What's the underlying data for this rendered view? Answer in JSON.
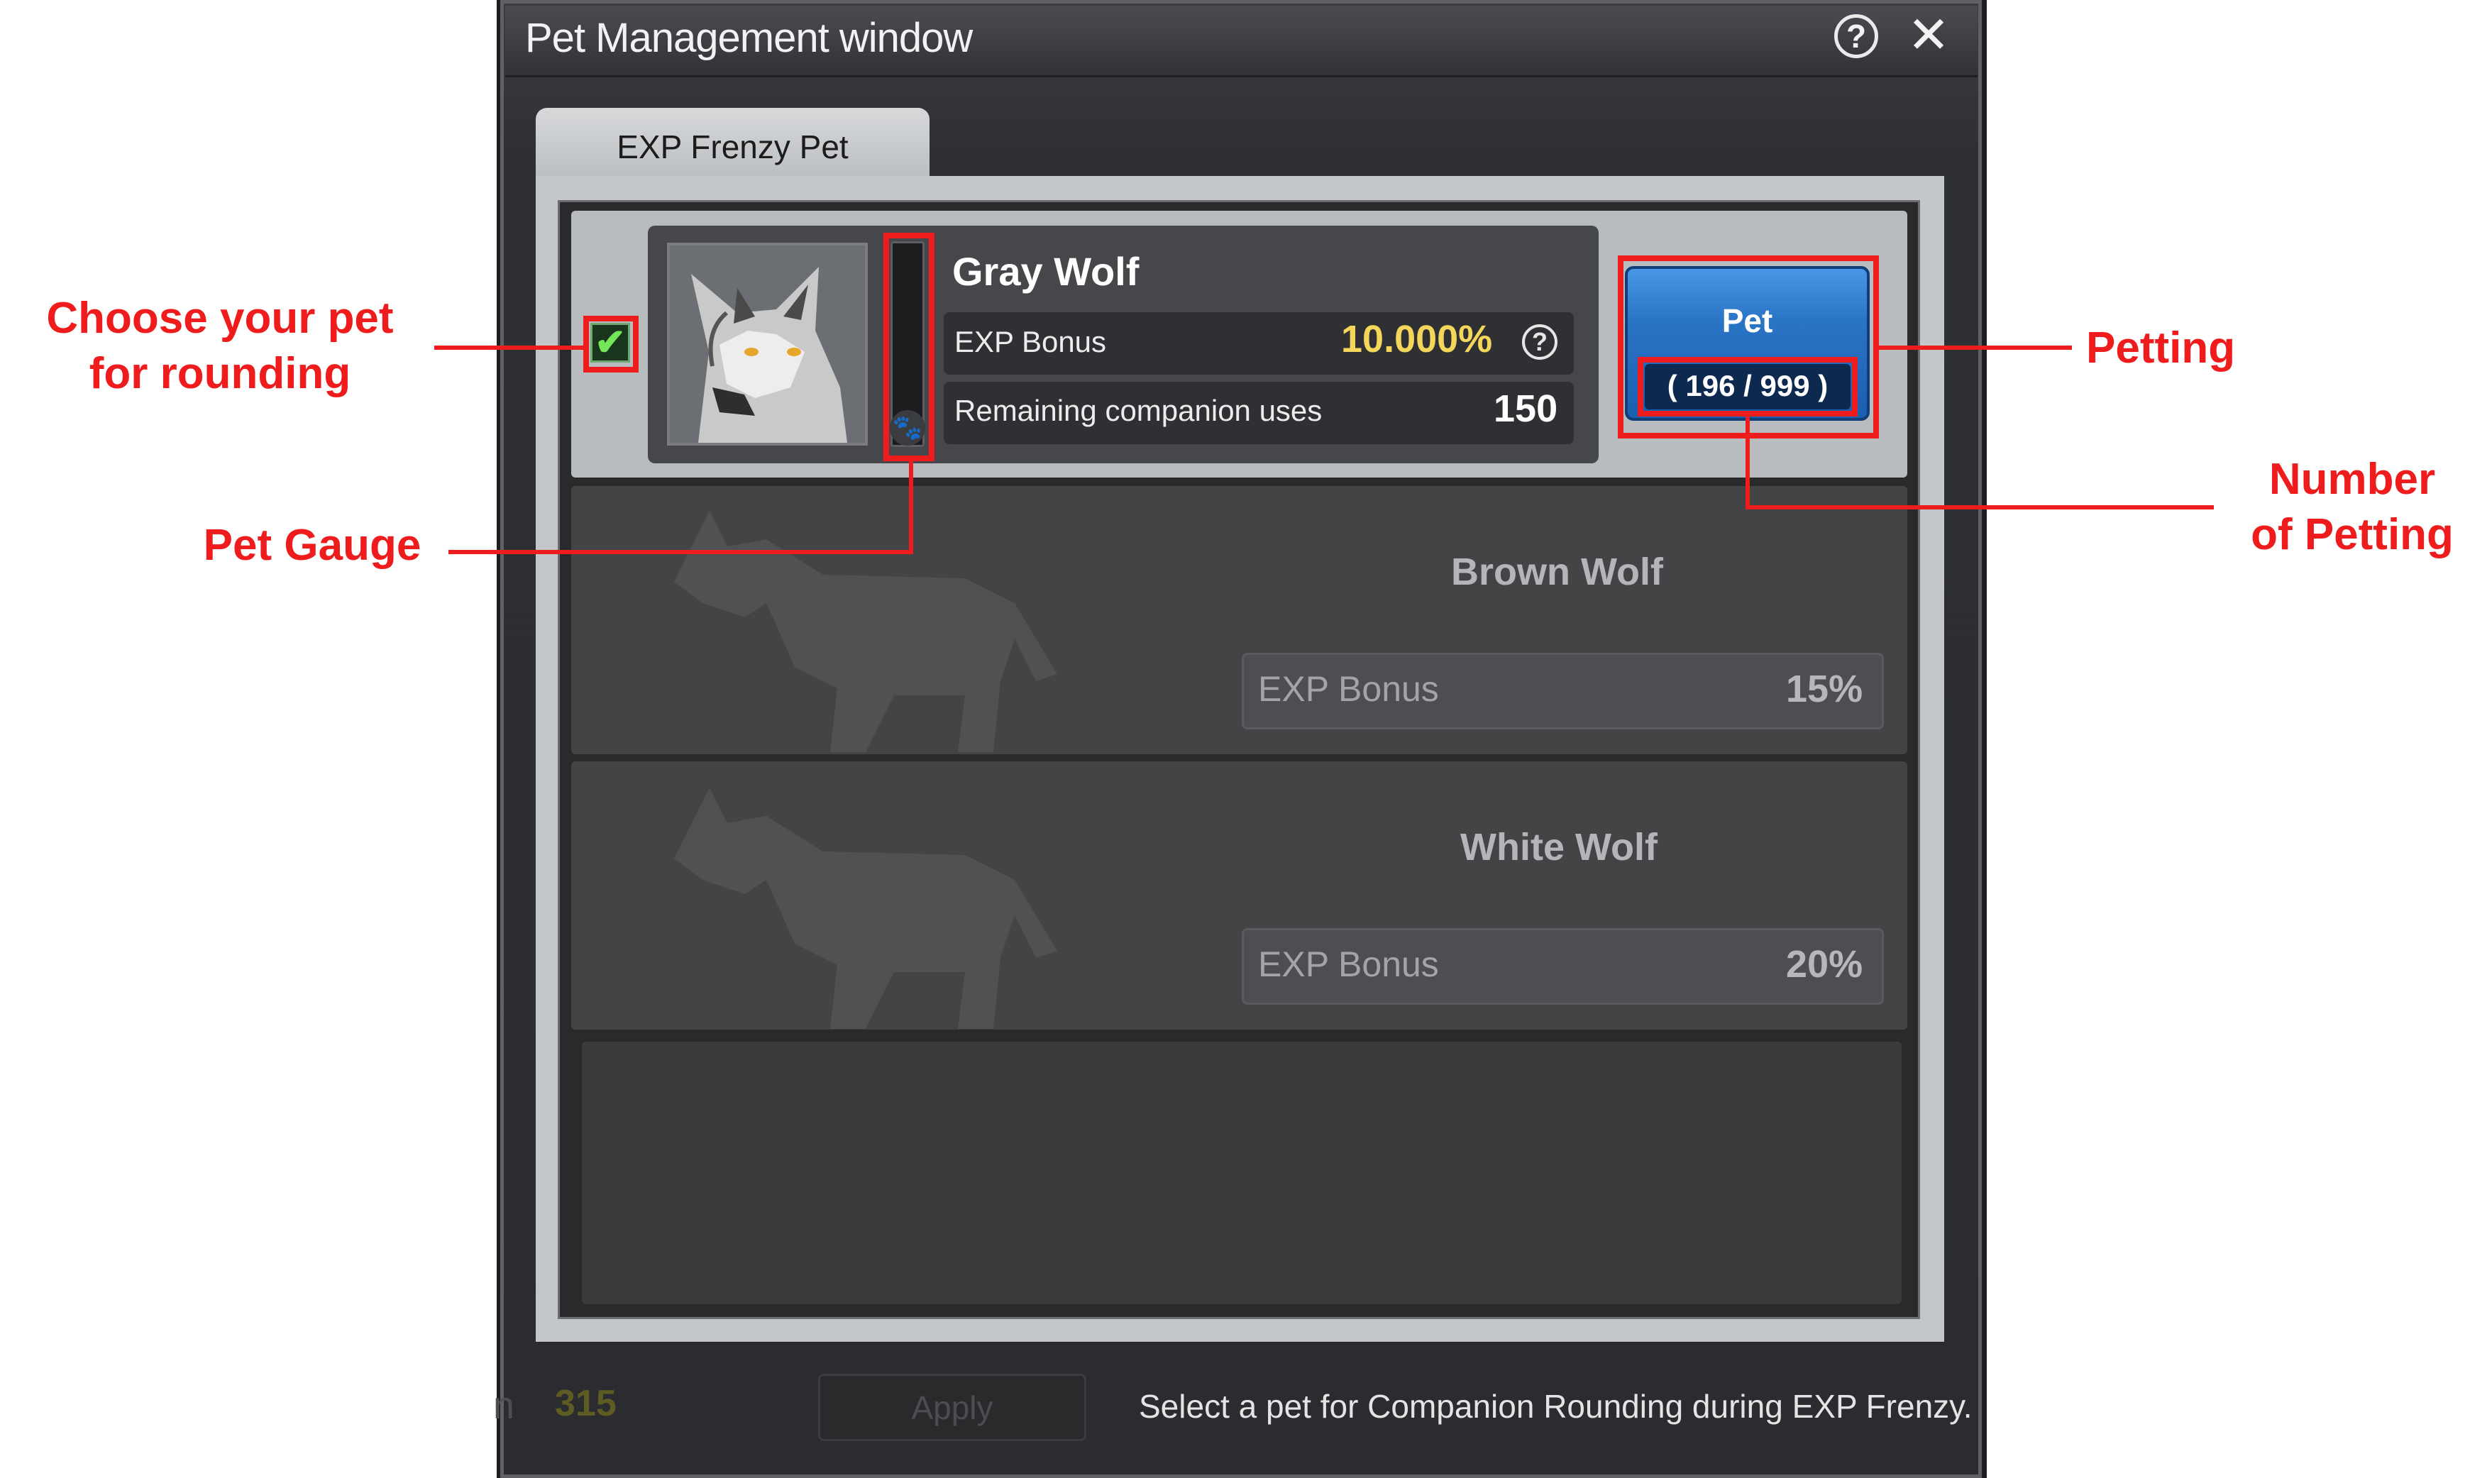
{
  "window": {
    "title": "Pet Management window",
    "help_icon": "question-circle-icon",
    "close_icon": "close-icon",
    "help_glyph": "?",
    "close_glyph": "✕"
  },
  "tabs": [
    {
      "label": "EXP Frenzy Pet"
    }
  ],
  "pets": [
    {
      "name": "Gray Wolf",
      "selected": true,
      "check_glyph": "✔",
      "exp_label": "EXP Bonus",
      "exp_value": "10.000%",
      "remaining_label": "Remaining companion uses",
      "remaining_value": "150",
      "gauge_level": 0,
      "pet_button_label": "Pet",
      "petting_count": "( 196 / 999 )",
      "paw_glyph": "🐾"
    },
    {
      "name": "Brown Wolf",
      "locked": true,
      "exp_label": "EXP Bonus",
      "exp_value": "15%"
    },
    {
      "name": "White Wolf",
      "locked": true,
      "exp_label": "EXP Bonus",
      "exp_value": "20%"
    }
  ],
  "footer": {
    "number_prefix": "n",
    "number": "315",
    "apply_label": "Apply",
    "hint": "Select a pet for Companion Rounding during EXP Frenzy."
  },
  "annotations": {
    "choose_pet": [
      "Choose your pet",
      "for rounding"
    ],
    "pet_gauge": "Pet Gauge",
    "petting": "Petting",
    "number_of_petting": [
      "Number",
      "of Petting"
    ]
  },
  "colors": {
    "annotation_red": "#ee1c1c",
    "exp_value_gold": "#f4d75a",
    "pet_button_blue": "#2a74c6",
    "check_green": "#74e65a"
  }
}
